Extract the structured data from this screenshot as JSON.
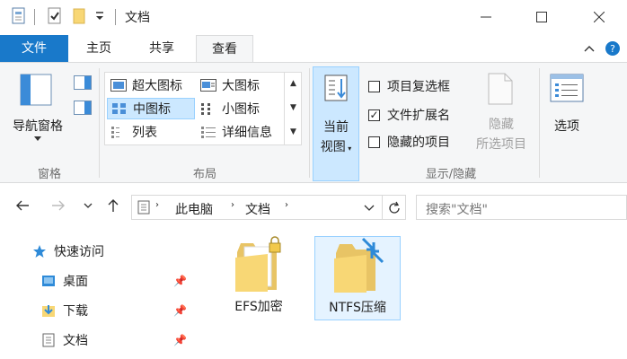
{
  "window": {
    "title": "文档",
    "controls": {
      "minimize": "—",
      "maximize": "☐",
      "close": "✕"
    }
  },
  "quick_access_toolbar": {
    "icons": [
      "properties-icon",
      "check-icon",
      "folder-icon",
      "dropdown-arrow-icon"
    ]
  },
  "ribbon_tabs": {
    "file": "文件",
    "home": "主页",
    "share": "共享",
    "view": "查看",
    "active": "查看"
  },
  "ribbon": {
    "panes": {
      "nav_pane_label": "导航窗格",
      "group_label": "窗格"
    },
    "layout": {
      "group_label": "布局",
      "items": {
        "extra_large": "超大图标",
        "large": "大图标",
        "medium": "中图标",
        "small": "小图标",
        "list": "列表",
        "details": "详细信息"
      },
      "selected": "中图标"
    },
    "current_view": {
      "label_line1": "当前",
      "label_line2": "视图"
    },
    "show_hide": {
      "group_label": "显示/隐藏",
      "item_checkboxes": {
        "label": "项目复选框",
        "checked": false
      },
      "file_extensions": {
        "label": "文件扩展名",
        "checked": true
      },
      "hidden_items": {
        "label": "隐藏的项目",
        "checked": false
      },
      "hide_selected_line1": "隐藏",
      "hide_selected_line2": "所选项目"
    },
    "options": {
      "label": "选项"
    }
  },
  "address": {
    "segments": [
      "此电脑",
      "文档"
    ],
    "search_placeholder": "搜索\"文档\""
  },
  "nav_pane": {
    "quick_access": "快速访问",
    "items": [
      {
        "label": "桌面",
        "pinned": true
      },
      {
        "label": "下载",
        "pinned": true
      },
      {
        "label": "文档",
        "pinned": true
      }
    ]
  },
  "files": [
    {
      "name": "EFS加密",
      "type": "encrypted-folder"
    },
    {
      "name": "NTFS压缩",
      "type": "compressed-folder",
      "selected": true
    }
  ],
  "colors": {
    "file_tab": "#1979ca",
    "selection": "#cce8ff",
    "selection_border": "#99d1ff",
    "ribbon_bg": "#f5f6f7",
    "folder_yellow": "#f8d775",
    "compress_blue": "#2e8ad8"
  }
}
